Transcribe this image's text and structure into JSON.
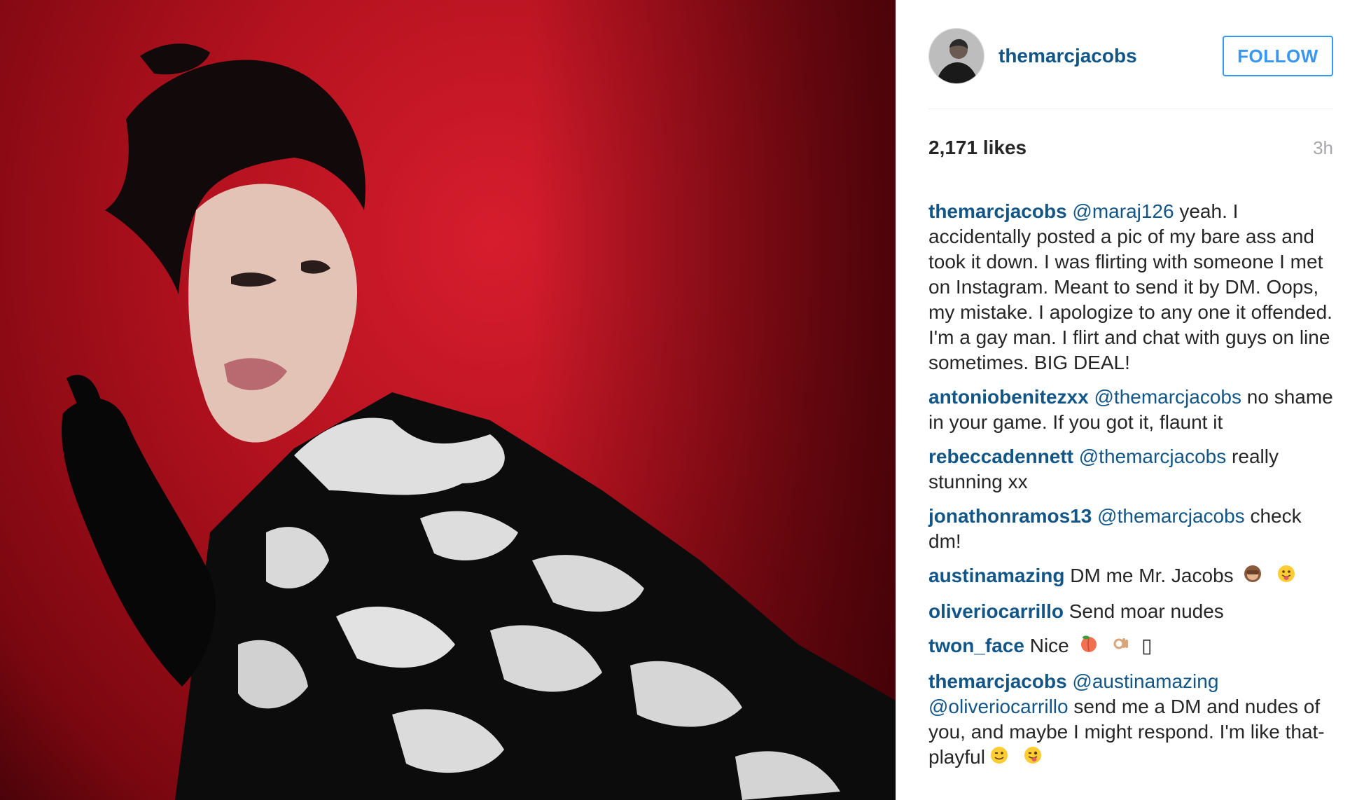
{
  "post": {
    "username": "themarcjacobs",
    "follow_label": "FOLLOW",
    "likes": "2,171 likes",
    "time": "3h"
  },
  "comments": [
    {
      "author": "themarcjacobs",
      "mention": "@maraj126",
      "text": " yeah. I accidentally posted a pic of my bare ass and took it down. I was flirting with someone I met on Instagram. Meant to send it by DM. Oops, my mistake. I apologize to any one it offended. I'm a gay man. I flirt and chat with guys on line sometimes. BIG DEAL!"
    },
    {
      "author": "antoniobenitezxx",
      "mention": "@themarcjacobs",
      "text": " no shame in your game. If you got it, flaunt it"
    },
    {
      "author": "rebeccadennett",
      "mention": "@themarcjacobs",
      "text": " really stunning xx"
    },
    {
      "author": "jonathonramos13",
      "mention": "@themarcjacobs",
      "text": " check dm!"
    },
    {
      "author": "austinamazing",
      "text": " DM me Mr. Jacobs",
      "emojis": [
        "see-no-evil-monkey-emoji",
        "tongue-out-emoji"
      ]
    },
    {
      "author": "oliveriocarrillo",
      "text": " Send moar nudes"
    },
    {
      "author": "twon_face",
      "text": " Nice",
      "emojis": [
        "peach-emoji",
        "ok-hand-emoji"
      ],
      "trailing": "▯"
    },
    {
      "author": "themarcjacobs",
      "mention": "@austinamazing",
      "mention2": "@oliveriocarrillo",
      "text": " send me a DM and nudes of you, and maybe I might respond. I'm like that- playful",
      "emojis": [
        "winking-face-emoji",
        "winking-tongue-emoji"
      ]
    }
  ],
  "colors": {
    "link": "#125688",
    "follow": "#3897f0",
    "text": "#262626",
    "muted": "#a5a7aa",
    "photo_red": "#c4121f"
  }
}
